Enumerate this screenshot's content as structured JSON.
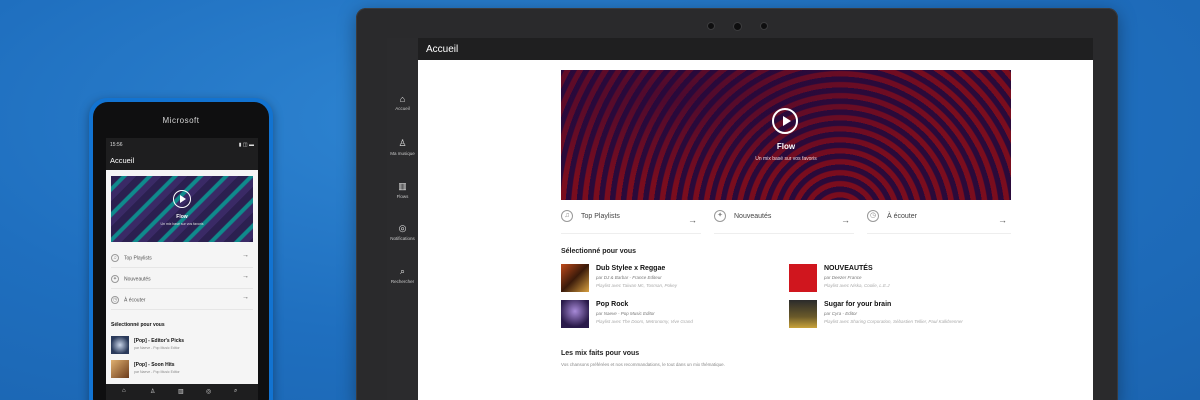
{
  "tablet": {
    "title": "Accueil",
    "rail": [
      {
        "icon": "home-icon",
        "glyph": "⌂",
        "label": "Accueil"
      },
      {
        "icon": "person-icon",
        "glyph": "♙",
        "label": "Ma musique"
      },
      {
        "icon": "charts-icon",
        "glyph": "▥",
        "label": "Flows"
      },
      {
        "icon": "notifications-icon",
        "glyph": "◎",
        "label": "Notifications"
      },
      {
        "icon": "search-icon",
        "glyph": "⌕",
        "label": "Rechercher"
      }
    ],
    "hero": {
      "title": "Flow",
      "subtitle": "Un mix basé sur vos favoris"
    },
    "quick": [
      {
        "icon": "playlist-icon",
        "glyph": "♫",
        "label": "Top Playlists"
      },
      {
        "icon": "new-releases-icon",
        "glyph": "✦",
        "label": "Nouveautés"
      },
      {
        "icon": "listen-later-icon",
        "glyph": "◷",
        "label": "À écouter"
      }
    ],
    "selected_title": "Sélectionné pour vous",
    "cards": [
      {
        "title": "Dub Stylee x Reggae",
        "sub": "par DJ & Barbar - France Editeur",
        "meta": "Playlist avec Taiwan Mc, Tosman, Pokey"
      },
      {
        "title": "NOUVEAUTÉS",
        "sub": "par Deezer France",
        "meta": "Playlist avec Niska, Coolie, L.E.J"
      },
      {
        "title": "Pop Rock",
        "sub": "par Naeve - Pop Music Editor",
        "meta": "Playlist avec The Doors, Metronomy, Vive Grand"
      },
      {
        "title": "Sugar for your brain",
        "sub": "par Cyra - Editor",
        "meta": "Playlist avec Sharing Corporation, Sébastien Tellier, Paul Kalkbrenner"
      }
    ],
    "mix_title": "Les mix faits pour vous",
    "mix_sub": "Vos chansons préférées et nos recommandations, le tout dans un mix thématique."
  },
  "phone": {
    "brand": "Microsoft",
    "time": "15:56",
    "status_right": "▮ ◫ ▬",
    "title": "Accueil",
    "hero": {
      "title": "Flow",
      "subtitle": "Un mix basé sur vos favoris"
    },
    "quick": [
      {
        "icon": "playlist-icon",
        "glyph": "♫",
        "label": "Top Playlists"
      },
      {
        "icon": "new-releases-icon",
        "glyph": "✦",
        "label": "Nouveautés"
      },
      {
        "icon": "listen-later-icon",
        "glyph": "◷",
        "label": "À écouter"
      }
    ],
    "selected_title": "Sélectionné pour vous",
    "items": [
      {
        "title": "[Pop] - Editor's Picks",
        "sub": "par Naeve - Pop Music Editor"
      },
      {
        "title": "[Pop] - Soon Hits",
        "sub": "par Naeve - Pop Music Editor"
      }
    ],
    "nav": [
      {
        "icon": "home-icon",
        "glyph": "⌂"
      },
      {
        "icon": "person-icon",
        "glyph": "♙"
      },
      {
        "icon": "charts-icon",
        "glyph": "▥"
      },
      {
        "icon": "notifications-icon",
        "glyph": "◎"
      },
      {
        "icon": "search-icon",
        "glyph": "⌕"
      }
    ]
  },
  "colors": {
    "background": "#1f6fbf",
    "phone_body": "#1273d1",
    "hero_red": "#7a0d1e",
    "hero_purple": "#2a0a3a"
  }
}
